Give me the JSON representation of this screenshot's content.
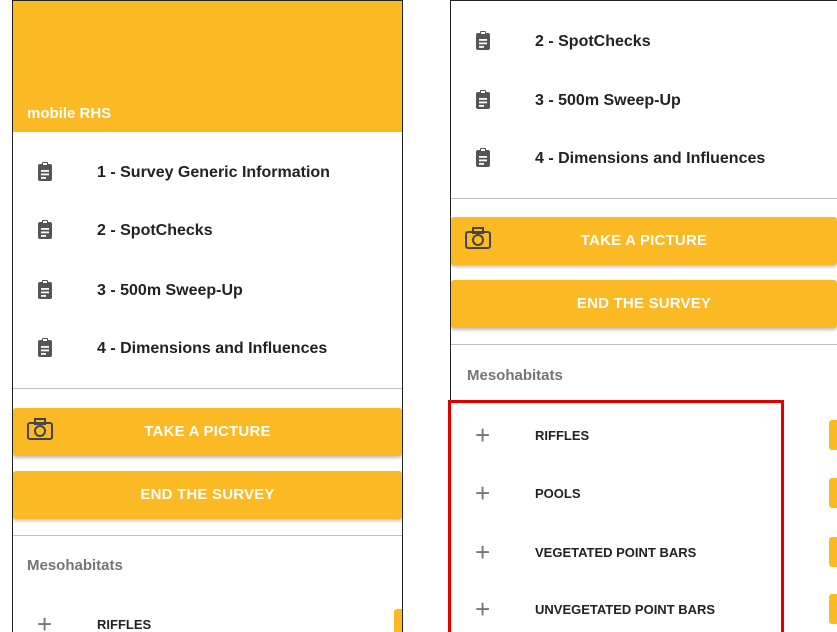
{
  "app": {
    "title": "mobile RHS",
    "accent_color": "#fbb923",
    "highlight_color": "#e00000"
  },
  "nav": {
    "items": [
      {
        "label": "1 - Survey Generic Information",
        "icon": "clipboard-icon"
      },
      {
        "label": "2 - SpotChecks",
        "icon": "clipboard-icon"
      },
      {
        "label": "3 - 500m Sweep-Up",
        "icon": "clipboard-icon"
      },
      {
        "label": "4 - Dimensions and Influences",
        "icon": "clipboard-icon"
      }
    ]
  },
  "actions": {
    "take_picture": "TAKE A PICTURE",
    "end_survey": "END THE SURVEY",
    "camera_icon": "camera-icon"
  },
  "mesohabitats": {
    "title": "Mesohabitats",
    "items": [
      {
        "label": "RIFFLES",
        "icon": "plus-icon"
      },
      {
        "label": "POOLS",
        "icon": "plus-icon"
      },
      {
        "label": "VEGETATED POINT BARS",
        "icon": "plus-icon"
      },
      {
        "label": "UNVEGETATED POINT BARS",
        "icon": "plus-icon"
      }
    ]
  }
}
